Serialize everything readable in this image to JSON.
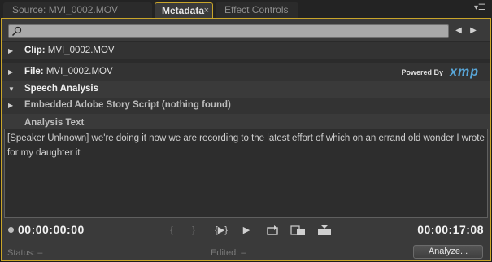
{
  "tabs": {
    "source": "Source: MVI_0002.MOV",
    "metadata": "Metadata",
    "metadata_close": "×",
    "effects": "Effect Controls"
  },
  "search": {
    "placeholder": "",
    "value": ""
  },
  "clip": {
    "key": "Clip:",
    "value": "MVI_0002.MOV"
  },
  "file": {
    "key": "File:",
    "value": "MVI_0002.MOV"
  },
  "xmp": {
    "powered_by": "Powered By",
    "logo": "xmp"
  },
  "speech": {
    "section_title": "Speech Analysis",
    "embedded": "Embedded Adobe Story Script (nothing found)",
    "analysis_label": "Analysis Text",
    "text": "[Speaker Unknown] we're doing it now we are recording to the latest effort of which on an errand old wonder I wrote for my daughter it"
  },
  "transport": {
    "current_tc": "00:00:00:00",
    "duration_tc": "00:00:17:08"
  },
  "status": {
    "status_text": "Status: –",
    "edited_text": "Edited: –"
  },
  "buttons": {
    "analyze": "Analyze..."
  },
  "colors": {
    "accent_border": "#c9a52a",
    "xmp_blue": "#58a6d8",
    "panel_bg": "#3a3a3a"
  }
}
